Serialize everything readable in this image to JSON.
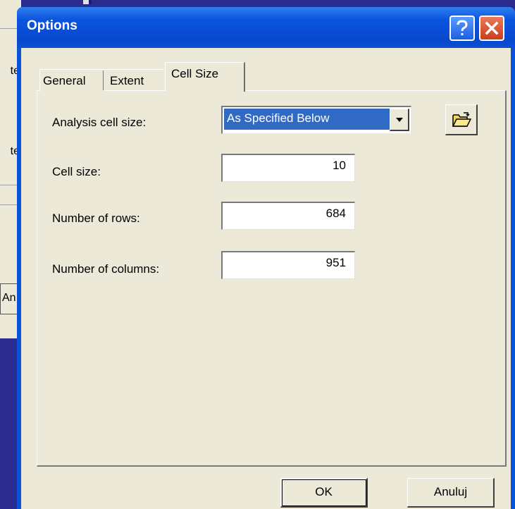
{
  "background": {
    "left_text_1": "te",
    "left_text_2": "te",
    "left_button_label": "An"
  },
  "dialog": {
    "title": "Options",
    "help_icon": "help-icon",
    "close_icon": "close-icon"
  },
  "tabs": [
    {
      "label": "General",
      "active": false
    },
    {
      "label": "Extent",
      "active": false
    },
    {
      "label": "Cell Size",
      "active": true
    }
  ],
  "form": {
    "analysis_cell_size_label": "Analysis cell size:",
    "analysis_cell_size_value": "As Specified Below",
    "cell_size_label": "Cell size:",
    "cell_size_value": "10",
    "rows_label": "Number of rows:",
    "rows_value": "684",
    "columns_label": "Number of columns:",
    "columns_value": "951",
    "browse_icon": "open-folder-icon"
  },
  "buttons": {
    "ok": "OK",
    "cancel": "Anuluj"
  },
  "colors": {
    "titlebar": "#0a52d8",
    "selection": "#316ac5",
    "face": "#ece9d8",
    "desktop": "#2b2b8f"
  }
}
